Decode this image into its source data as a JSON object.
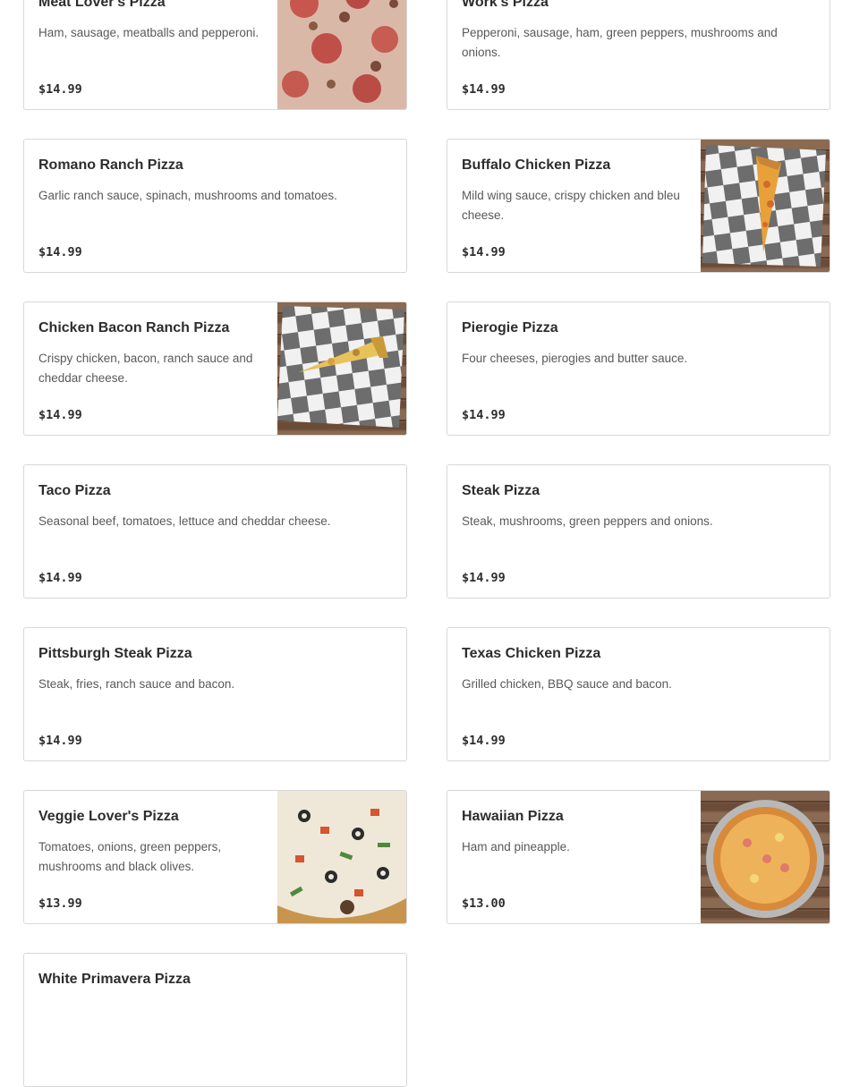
{
  "menu_items": [
    {
      "name": "Meat Lover's Pizza",
      "description": "Ham, sausage, meatballs and pepperoni.",
      "price": "$14.99",
      "photo": "meat-pizza-photo"
    },
    {
      "name": "Work's Pizza",
      "description": "Pepperoni, sausage, ham, green peppers, mushrooms and onions.",
      "price": "$14.99"
    },
    {
      "name": "Romano Ranch Pizza",
      "description": "Garlic ranch sauce, spinach, mushrooms and tomatoes.",
      "price": "$14.99"
    },
    {
      "name": "Buffalo Chicken Pizza",
      "description": "Mild wing sauce, crispy chicken and bleu cheese.",
      "price": "$14.99",
      "photo": "pizza-slice-photo"
    },
    {
      "name": "Chicken Bacon Ranch Pizza",
      "description": "Crispy chicken, bacon, ranch sauce and cheddar cheese.",
      "price": "$14.99",
      "photo": "pizza-slice-photo"
    },
    {
      "name": "Pierogie Pizza",
      "description": "Four cheeses, pierogies and butter sauce.",
      "price": "$14.99"
    },
    {
      "name": "Taco Pizza",
      "description": "Seasonal beef, tomatoes, lettuce and cheddar cheese.",
      "price": "$14.99"
    },
    {
      "name": "Steak Pizza",
      "description": "Steak, mushrooms, green peppers and onions.",
      "price": "$14.99"
    },
    {
      "name": "Pittsburgh Steak Pizza",
      "description": "Steak, fries, ranch sauce and bacon.",
      "price": "$14.99"
    },
    {
      "name": "Texas Chicken Pizza",
      "description": "Grilled chicken, BBQ sauce and bacon.",
      "price": "$14.99"
    },
    {
      "name": "Veggie Lover's Pizza",
      "description": "Tomatoes, onions, green peppers, mushrooms and black olives.",
      "price": "$13.99",
      "photo": "veggie-pizza-photo"
    },
    {
      "name": "Hawaiian Pizza",
      "description": "Ham and pineapple.",
      "price": "$13.00",
      "photo": "whole-pizza-photo"
    },
    {
      "name": "White Primavera Pizza",
      "description": "",
      "price": ""
    }
  ],
  "colors": {
    "border": "#d8d8d8",
    "title": "#2d2d2d",
    "description": "#595959"
  }
}
